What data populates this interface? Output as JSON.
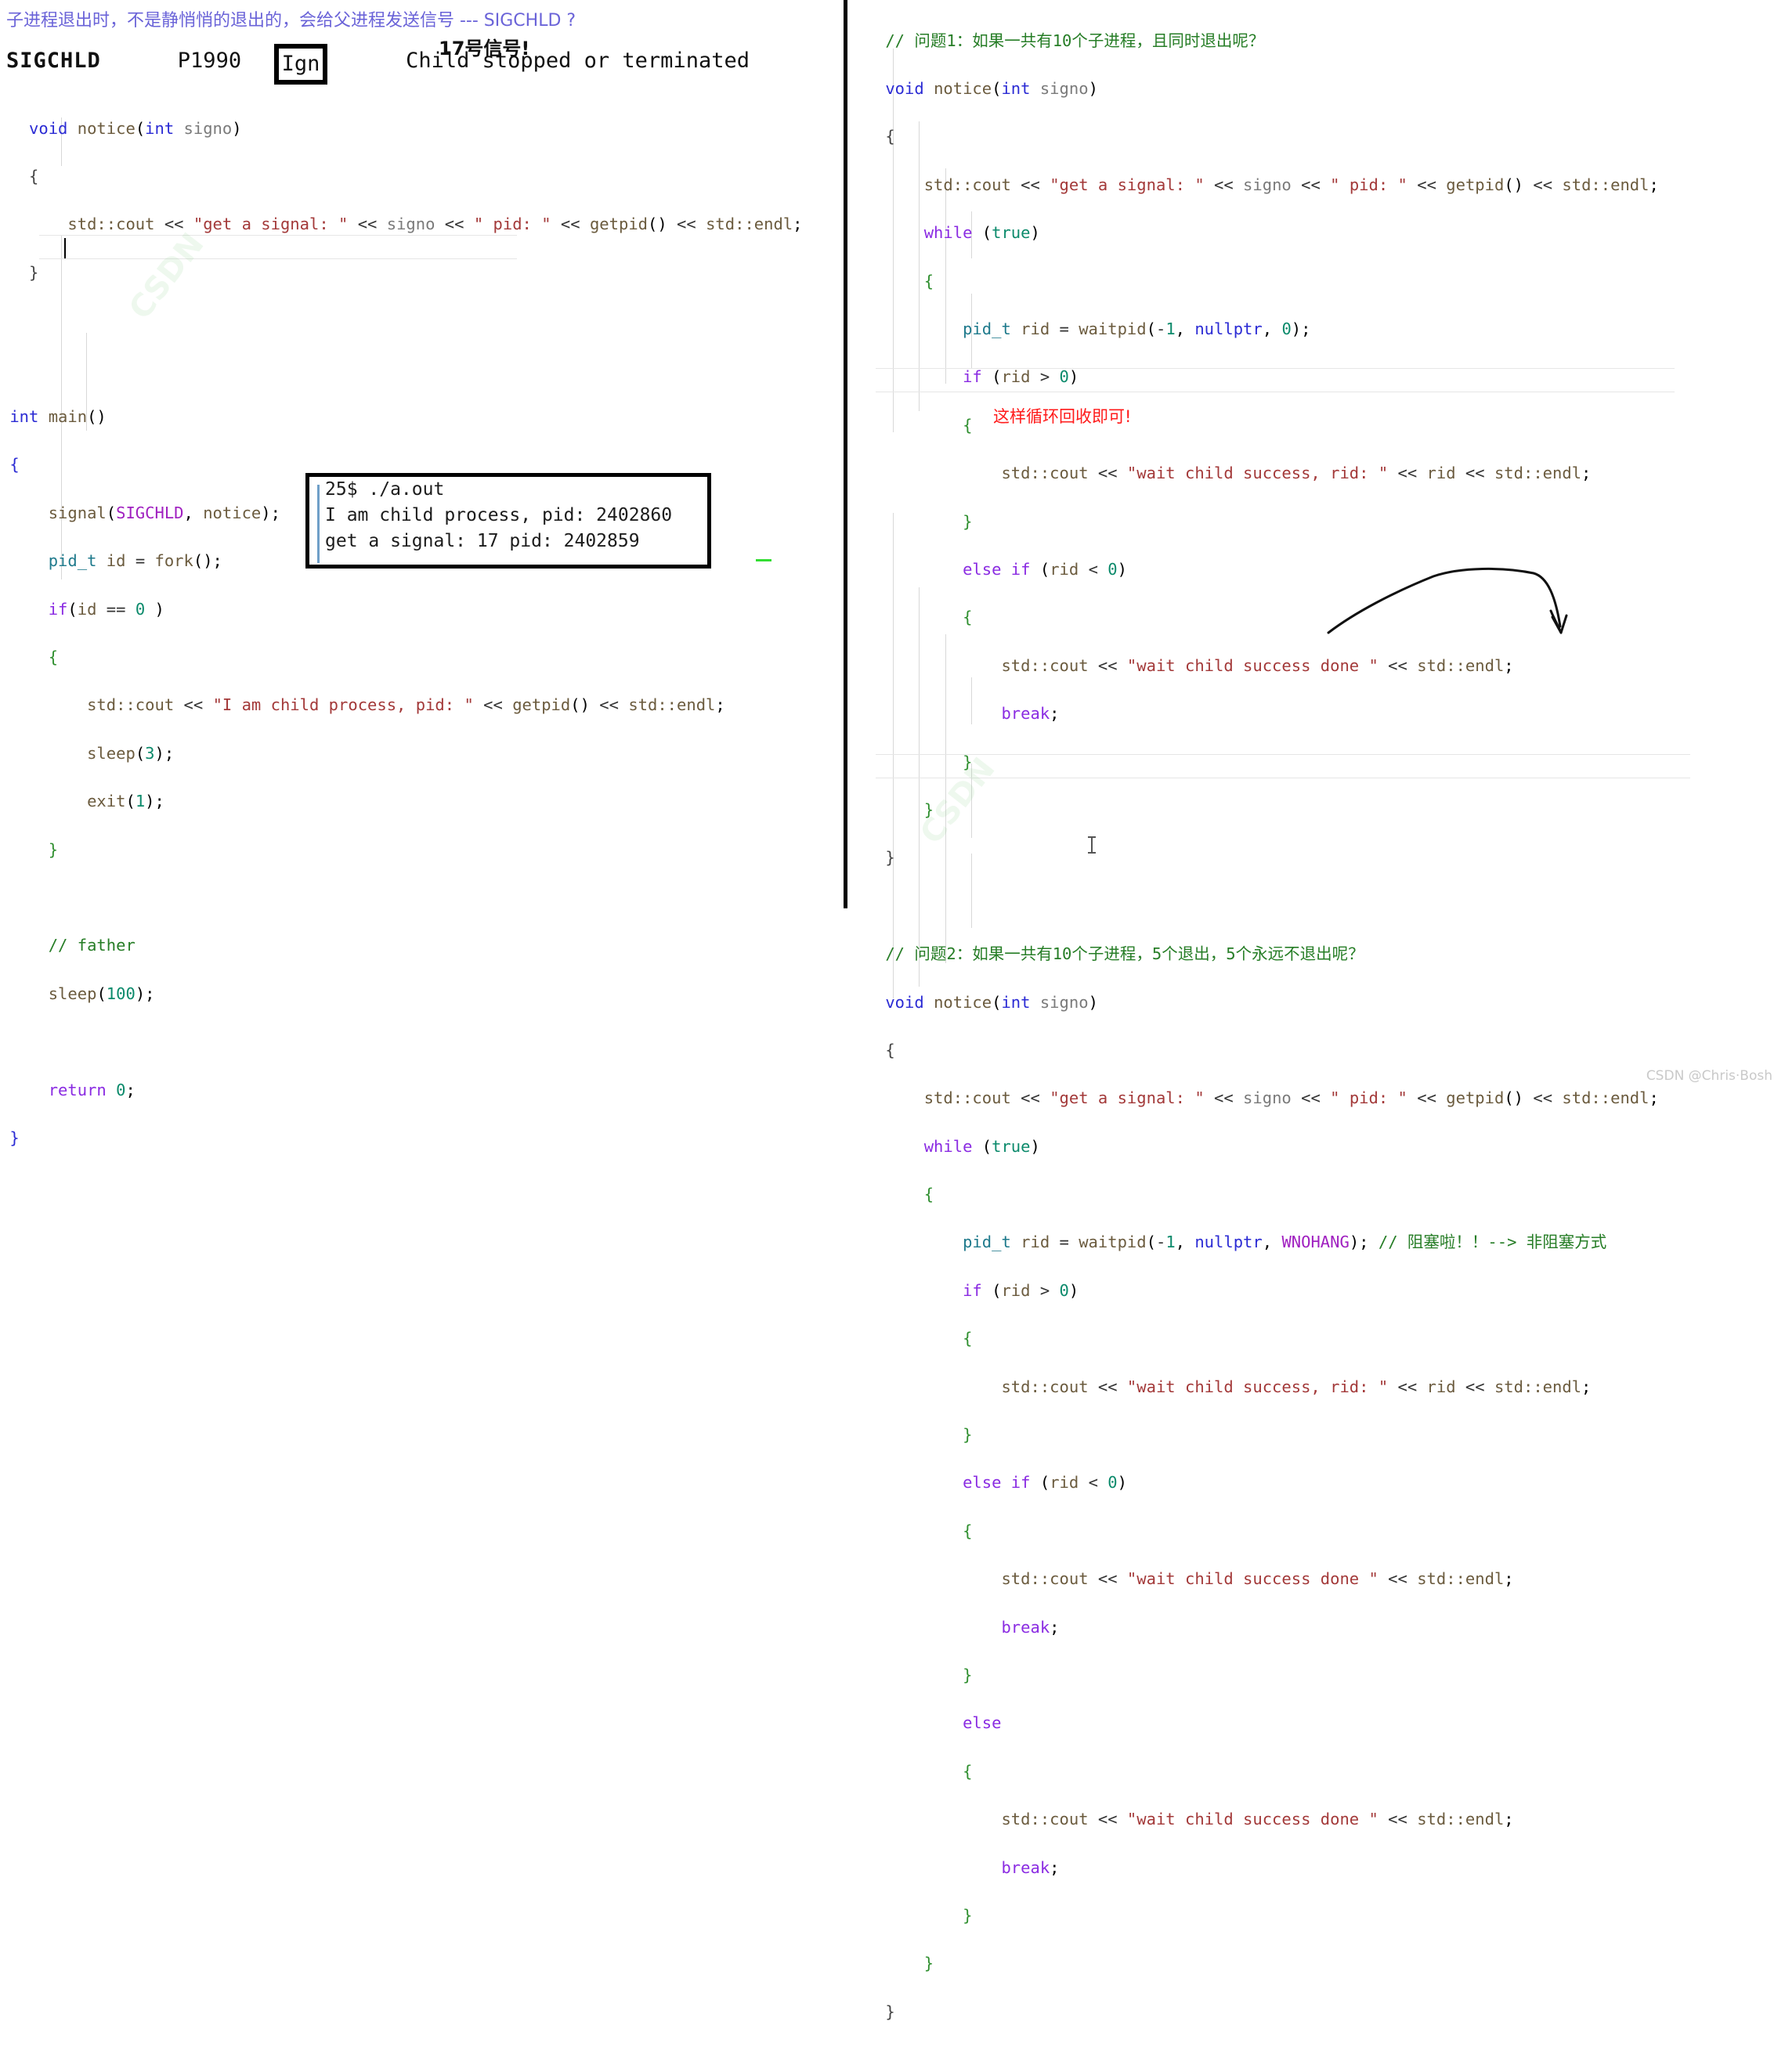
{
  "left": {
    "header_note": "子进程退出时，不是静悄悄的退出的，会给父进程发送信号 --- SIGCHLD ?",
    "signal_number_note": "17号信号!",
    "signal_row": {
      "name": "SIGCHLD",
      "pnum": "P1990",
      "action": "Ign",
      "description": "Child stopped or terminated"
    },
    "code_lines": [
      "void notice(int signo)",
      "{",
      "    std::cout << \"get a signal: \" << signo << \" pid: \" << getpid() << std::endl;",
      "}",
      "",
      "int main()",
      "{",
      "    signal(SIGCHLD, notice);",
      "    pid_t id = fork();",
      "    if(id == 0 )",
      "    {",
      "        std::cout << \"I am child process, pid: \" << getpid() << std::endl;",
      "        sleep(3);",
      "        exit(1);",
      "    }",
      "",
      "    // father",
      "    sleep(100);",
      "",
      "    return 0;",
      "}"
    ],
    "terminal": {
      "line1": "25$ ./a.out",
      "line2": "I am child process, pid: 2402860",
      "line3": "get a signal: 17 pid: 2402859"
    }
  },
  "right": {
    "question1_comment": "// 问题1：如果一共有10个子进程，且同时退出呢？",
    "block1_lines": [
      "void notice(int signo)",
      "{",
      "    std::cout << \"get a signal: \" << signo << \" pid: \" << getpid() << std::endl;",
      "    while (true)",
      "    {",
      "        pid_t rid = waitpid(-1, nullptr, 0);",
      "        if (rid > 0)",
      "        {",
      "            std::cout << \"wait child success, rid: \" << rid << std::endl;",
      "        }",
      "        else if (rid < 0)",
      "        {",
      "            std::cout << \"wait child success done \" << std::endl;",
      "            break;",
      "        }",
      "    }",
      "}"
    ],
    "red_annotation": "这样循环回收即可!",
    "question2_comment": "// 问题2：如果一共有10个子进程，5个退出，5个永远不退出呢？",
    "block2_lines": [
      "void notice(int signo)",
      "{",
      "    std::cout << \"get a signal: \" << signo << \" pid: \" << getpid() << std::endl;",
      "    while (true)",
      "    {",
      "        pid_t rid = waitpid(-1, nullptr, WNOHANG); // 阻塞啦！！--> 非阻塞方式",
      "        if (rid > 0)",
      "        {",
      "            std::cout << \"wait child success, rid: \" << rid << std::endl;",
      "        }",
      "        else if (rid < 0)",
      "        {",
      "            std::cout << \"wait child success done \" << std::endl;",
      "            break;",
      "        }",
      "        else",
      "        {",
      "            std::cout << \"wait child success done \" << std::endl;",
      "            break;",
      "        }",
      "    }",
      "}"
    ],
    "inline_comment2": "// 阻塞啦！！--> 非阻塞方式",
    "wnohang_flag": "WNOHANG"
  },
  "watermark": "CSDN @Chris·Bosh",
  "colors": {
    "keyword": "#2b2bd4",
    "control": "#8a2be2",
    "string": "#a33939",
    "comment": "#267d26",
    "macro": "#a020c0",
    "number": "#0b8a6b",
    "red_note": "#ff1a1a",
    "header_note": "#6a63d8"
  }
}
